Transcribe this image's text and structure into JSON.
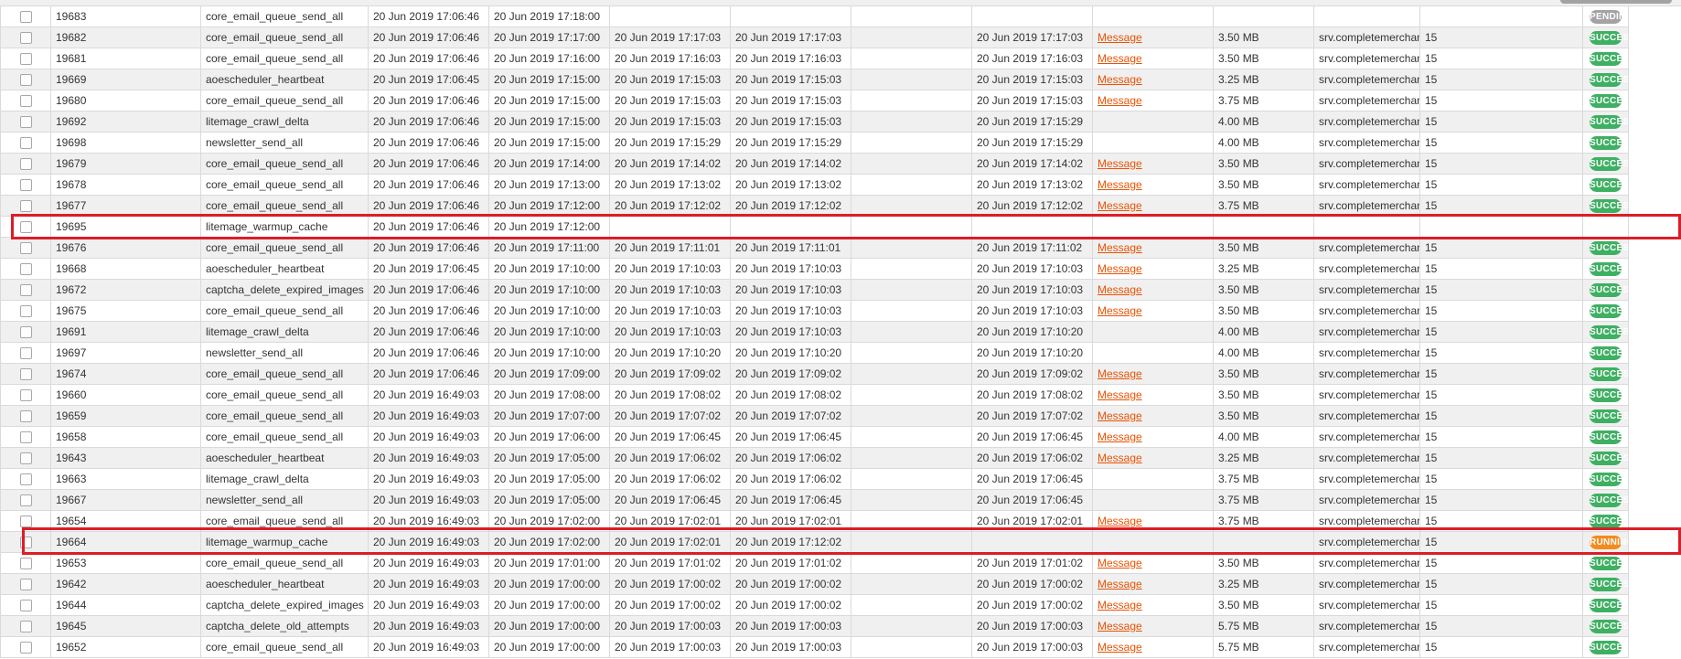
{
  "rows": [
    {
      "id": "19683",
      "code": "core_email_queue_send_all",
      "created": "20 Jun 2019 17:06:46",
      "scheduled": "20 Jun 2019 17:18:00",
      "executed": "",
      "finished": "",
      "c7": "",
      "last": "",
      "messages": "",
      "memory": "",
      "host": "",
      "pid": "",
      "status": "PENDING",
      "status_type": "pending"
    },
    {
      "id": "19682",
      "code": "core_email_queue_send_all",
      "created": "20 Jun 2019 17:06:46",
      "scheduled": "20 Jun 2019 17:17:00",
      "executed": "20 Jun 2019 17:17:03",
      "finished": "20 Jun 2019 17:17:03",
      "c7": "",
      "last": "20 Jun 2019 17:17:03",
      "messages": "Message",
      "memory": "3.50 MB",
      "host": "srv.completemerchandise.co.uk",
      "pid": "15",
      "status": "SUCCESS",
      "status_type": "success"
    },
    {
      "id": "19681",
      "code": "core_email_queue_send_all",
      "created": "20 Jun 2019 17:06:46",
      "scheduled": "20 Jun 2019 17:16:00",
      "executed": "20 Jun 2019 17:16:03",
      "finished": "20 Jun 2019 17:16:03",
      "c7": "",
      "last": "20 Jun 2019 17:16:03",
      "messages": "Message",
      "memory": "3.50 MB",
      "host": "srv.completemerchandise.co.uk",
      "pid": "15",
      "status": "SUCCESS",
      "status_type": "success"
    },
    {
      "id": "19669",
      "code": "aoescheduler_heartbeat",
      "created": "20 Jun 2019 17:06:45",
      "scheduled": "20 Jun 2019 17:15:00",
      "executed": "20 Jun 2019 17:15:03",
      "finished": "20 Jun 2019 17:15:03",
      "c7": "",
      "last": "20 Jun 2019 17:15:03",
      "messages": "Message",
      "memory": "3.25 MB",
      "host": "srv.completemerchandise.co.uk",
      "pid": "15",
      "status": "SUCCESS",
      "status_type": "success"
    },
    {
      "id": "19680",
      "code": "core_email_queue_send_all",
      "created": "20 Jun 2019 17:06:46",
      "scheduled": "20 Jun 2019 17:15:00",
      "executed": "20 Jun 2019 17:15:03",
      "finished": "20 Jun 2019 17:15:03",
      "c7": "",
      "last": "20 Jun 2019 17:15:03",
      "messages": "Message",
      "memory": "3.75 MB",
      "host": "srv.completemerchandise.co.uk",
      "pid": "15",
      "status": "SUCCESS",
      "status_type": "success"
    },
    {
      "id": "19692",
      "code": "litemage_crawl_delta",
      "created": "20 Jun 2019 17:06:46",
      "scheduled": "20 Jun 2019 17:15:00",
      "executed": "20 Jun 2019 17:15:03",
      "finished": "20 Jun 2019 17:15:03",
      "c7": "",
      "last": "20 Jun 2019 17:15:29",
      "messages": "",
      "memory": "4.00 MB",
      "host": "srv.completemerchandise.co.uk",
      "pid": "15",
      "status": "SUCCESS",
      "status_type": "success"
    },
    {
      "id": "19698",
      "code": "newsletter_send_all",
      "created": "20 Jun 2019 17:06:46",
      "scheduled": "20 Jun 2019 17:15:00",
      "executed": "20 Jun 2019 17:15:29",
      "finished": "20 Jun 2019 17:15:29",
      "c7": "",
      "last": "20 Jun 2019 17:15:29",
      "messages": "",
      "memory": "4.00 MB",
      "host": "srv.completemerchandise.co.uk",
      "pid": "15",
      "status": "SUCCESS",
      "status_type": "success"
    },
    {
      "id": "19679",
      "code": "core_email_queue_send_all",
      "created": "20 Jun 2019 17:06:46",
      "scheduled": "20 Jun 2019 17:14:00",
      "executed": "20 Jun 2019 17:14:02",
      "finished": "20 Jun 2019 17:14:02",
      "c7": "",
      "last": "20 Jun 2019 17:14:02",
      "messages": "Message",
      "memory": "3.50 MB",
      "host": "srv.completemerchandise.co.uk",
      "pid": "15",
      "status": "SUCCESS",
      "status_type": "success"
    },
    {
      "id": "19678",
      "code": "core_email_queue_send_all",
      "created": "20 Jun 2019 17:06:46",
      "scheduled": "20 Jun 2019 17:13:00",
      "executed": "20 Jun 2019 17:13:02",
      "finished": "20 Jun 2019 17:13:02",
      "c7": "",
      "last": "20 Jun 2019 17:13:02",
      "messages": "Message",
      "memory": "3.50 MB",
      "host": "srv.completemerchandise.co.uk",
      "pid": "15",
      "status": "SUCCESS",
      "status_type": "success"
    },
    {
      "id": "19677",
      "code": "core_email_queue_send_all",
      "created": "20 Jun 2019 17:06:46",
      "scheduled": "20 Jun 2019 17:12:00",
      "executed": "20 Jun 2019 17:12:02",
      "finished": "20 Jun 2019 17:12:02",
      "c7": "",
      "last": "20 Jun 2019 17:12:02",
      "messages": "Message",
      "memory": "3.75 MB",
      "host": "srv.completemerchandise.co.uk",
      "pid": "15",
      "status": "SUCCESS",
      "status_type": "success"
    },
    {
      "id": "19695",
      "code": "litemage_warmup_cache",
      "created": "20 Jun 2019 17:06:46",
      "scheduled": "20 Jun 2019 17:12:00",
      "executed": "",
      "finished": "",
      "c7": "",
      "last": "",
      "messages": "",
      "memory": "",
      "host": "",
      "pid": "",
      "status": "",
      "status_type": "none"
    },
    {
      "id": "19676",
      "code": "core_email_queue_send_all",
      "created": "20 Jun 2019 17:06:46",
      "scheduled": "20 Jun 2019 17:11:00",
      "executed": "20 Jun 2019 17:11:01",
      "finished": "20 Jun 2019 17:11:01",
      "c7": "",
      "last": "20 Jun 2019 17:11:02",
      "messages": "Message",
      "memory": "3.50 MB",
      "host": "srv.completemerchandise.co.uk",
      "pid": "15",
      "status": "SUCCESS",
      "status_type": "success"
    },
    {
      "id": "19668",
      "code": "aoescheduler_heartbeat",
      "created": "20 Jun 2019 17:06:45",
      "scheduled": "20 Jun 2019 17:10:00",
      "executed": "20 Jun 2019 17:10:03",
      "finished": "20 Jun 2019 17:10:03",
      "c7": "",
      "last": "20 Jun 2019 17:10:03",
      "messages": "Message",
      "memory": "3.25 MB",
      "host": "srv.completemerchandise.co.uk",
      "pid": "15",
      "status": "SUCCESS",
      "status_type": "success"
    },
    {
      "id": "19672",
      "code": "captcha_delete_expired_images",
      "created": "20 Jun 2019 17:06:46",
      "scheduled": "20 Jun 2019 17:10:00",
      "executed": "20 Jun 2019 17:10:03",
      "finished": "20 Jun 2019 17:10:03",
      "c7": "",
      "last": "20 Jun 2019 17:10:03",
      "messages": "Message",
      "memory": "3.50 MB",
      "host": "srv.completemerchandise.co.uk",
      "pid": "15",
      "status": "SUCCESS",
      "status_type": "success"
    },
    {
      "id": "19675",
      "code": "core_email_queue_send_all",
      "created": "20 Jun 2019 17:06:46",
      "scheduled": "20 Jun 2019 17:10:00",
      "executed": "20 Jun 2019 17:10:03",
      "finished": "20 Jun 2019 17:10:03",
      "c7": "",
      "last": "20 Jun 2019 17:10:03",
      "messages": "Message",
      "memory": "3.50 MB",
      "host": "srv.completemerchandise.co.uk",
      "pid": "15",
      "status": "SUCCESS",
      "status_type": "success"
    },
    {
      "id": "19691",
      "code": "litemage_crawl_delta",
      "created": "20 Jun 2019 17:06:46",
      "scheduled": "20 Jun 2019 17:10:00",
      "executed": "20 Jun 2019 17:10:03",
      "finished": "20 Jun 2019 17:10:03",
      "c7": "",
      "last": "20 Jun 2019 17:10:20",
      "messages": "",
      "memory": "4.00 MB",
      "host": "srv.completemerchandise.co.uk",
      "pid": "15",
      "status": "SUCCESS",
      "status_type": "success"
    },
    {
      "id": "19697",
      "code": "newsletter_send_all",
      "created": "20 Jun 2019 17:06:46",
      "scheduled": "20 Jun 2019 17:10:00",
      "executed": "20 Jun 2019 17:10:20",
      "finished": "20 Jun 2019 17:10:20",
      "c7": "",
      "last": "20 Jun 2019 17:10:20",
      "messages": "",
      "memory": "4.00 MB",
      "host": "srv.completemerchandise.co.uk",
      "pid": "15",
      "status": "SUCCESS",
      "status_type": "success"
    },
    {
      "id": "19674",
      "code": "core_email_queue_send_all",
      "created": "20 Jun 2019 17:06:46",
      "scheduled": "20 Jun 2019 17:09:00",
      "executed": "20 Jun 2019 17:09:02",
      "finished": "20 Jun 2019 17:09:02",
      "c7": "",
      "last": "20 Jun 2019 17:09:02",
      "messages": "Message",
      "memory": "3.50 MB",
      "host": "srv.completemerchandise.co.uk",
      "pid": "15",
      "status": "SUCCESS",
      "status_type": "success"
    },
    {
      "id": "19660",
      "code": "core_email_queue_send_all",
      "created": "20 Jun 2019 16:49:03",
      "scheduled": "20 Jun 2019 17:08:00",
      "executed": "20 Jun 2019 17:08:02",
      "finished": "20 Jun 2019 17:08:02",
      "c7": "",
      "last": "20 Jun 2019 17:08:02",
      "messages": "Message",
      "memory": "3.50 MB",
      "host": "srv.completemerchandise.co.uk",
      "pid": "15",
      "status": "SUCCESS",
      "status_type": "success"
    },
    {
      "id": "19659",
      "code": "core_email_queue_send_all",
      "created": "20 Jun 2019 16:49:03",
      "scheduled": "20 Jun 2019 17:07:00",
      "executed": "20 Jun 2019 17:07:02",
      "finished": "20 Jun 2019 17:07:02",
      "c7": "",
      "last": "20 Jun 2019 17:07:02",
      "messages": "Message",
      "memory": "3.50 MB",
      "host": "srv.completemerchandise.co.uk",
      "pid": "15",
      "status": "SUCCESS",
      "status_type": "success"
    },
    {
      "id": "19658",
      "code": "core_email_queue_send_all",
      "created": "20 Jun 2019 16:49:03",
      "scheduled": "20 Jun 2019 17:06:00",
      "executed": "20 Jun 2019 17:06:45",
      "finished": "20 Jun 2019 17:06:45",
      "c7": "",
      "last": "20 Jun 2019 17:06:45",
      "messages": "Message",
      "memory": "4.00 MB",
      "host": "srv.completemerchandise.co.uk",
      "pid": "15",
      "status": "SUCCESS",
      "status_type": "success"
    },
    {
      "id": "19643",
      "code": "aoescheduler_heartbeat",
      "created": "20 Jun 2019 16:49:03",
      "scheduled": "20 Jun 2019 17:05:00",
      "executed": "20 Jun 2019 17:06:02",
      "finished": "20 Jun 2019 17:06:02",
      "c7": "",
      "last": "20 Jun 2019 17:06:02",
      "messages": "Message",
      "memory": "3.25 MB",
      "host": "srv.completemerchandise.co.uk",
      "pid": "15",
      "status": "SUCCESS",
      "status_type": "success"
    },
    {
      "id": "19663",
      "code": "litemage_crawl_delta",
      "created": "20 Jun 2019 16:49:03",
      "scheduled": "20 Jun 2019 17:05:00",
      "executed": "20 Jun 2019 17:06:02",
      "finished": "20 Jun 2019 17:06:02",
      "c7": "",
      "last": "20 Jun 2019 17:06:45",
      "messages": "",
      "memory": "3.75 MB",
      "host": "srv.completemerchandise.co.uk",
      "pid": "15",
      "status": "SUCCESS",
      "status_type": "success"
    },
    {
      "id": "19667",
      "code": "newsletter_send_all",
      "created": "20 Jun 2019 16:49:03",
      "scheduled": "20 Jun 2019 17:05:00",
      "executed": "20 Jun 2019 17:06:45",
      "finished": "20 Jun 2019 17:06:45",
      "c7": "",
      "last": "20 Jun 2019 17:06:45",
      "messages": "",
      "memory": "3.75 MB",
      "host": "srv.completemerchandise.co.uk",
      "pid": "15",
      "status": "SUCCESS",
      "status_type": "success"
    },
    {
      "id": "19654",
      "code": "core_email_queue_send_all",
      "created": "20 Jun 2019 16:49:03",
      "scheduled": "20 Jun 2019 17:02:00",
      "executed": "20 Jun 2019 17:02:01",
      "finished": "20 Jun 2019 17:02:01",
      "c7": "",
      "last": "20 Jun 2019 17:02:01",
      "messages": "Message",
      "memory": "3.75 MB",
      "host": "srv.completemerchandise.co.uk",
      "pid": "15",
      "status": "SUCCESS",
      "status_type": "success"
    },
    {
      "id": "19664",
      "code": "litemage_warmup_cache",
      "created": "20 Jun 2019 16:49:03",
      "scheduled": "20 Jun 2019 17:02:00",
      "executed": "20 Jun 2019 17:02:01",
      "finished": "20 Jun 2019 17:12:02",
      "c7": "",
      "last": "",
      "messages": "",
      "memory": "",
      "host": "srv.completemerchandise.co.uk",
      "pid": "15",
      "status": "RUNNING",
      "status_type": "running"
    },
    {
      "id": "19653",
      "code": "core_email_queue_send_all",
      "created": "20 Jun 2019 16:49:03",
      "scheduled": "20 Jun 2019 17:01:00",
      "executed": "20 Jun 2019 17:01:02",
      "finished": "20 Jun 2019 17:01:02",
      "c7": "",
      "last": "20 Jun 2019 17:01:02",
      "messages": "Message",
      "memory": "3.50 MB",
      "host": "srv.completemerchandise.co.uk",
      "pid": "15",
      "status": "SUCCESS",
      "status_type": "success"
    },
    {
      "id": "19642",
      "code": "aoescheduler_heartbeat",
      "created": "20 Jun 2019 16:49:03",
      "scheduled": "20 Jun 2019 17:00:00",
      "executed": "20 Jun 2019 17:00:02",
      "finished": "20 Jun 2019 17:00:02",
      "c7": "",
      "last": "20 Jun 2019 17:00:02",
      "messages": "Message",
      "memory": "3.25 MB",
      "host": "srv.completemerchandise.co.uk",
      "pid": "15",
      "status": "SUCCESS",
      "status_type": "success"
    },
    {
      "id": "19644",
      "code": "captcha_delete_expired_images",
      "created": "20 Jun 2019 16:49:03",
      "scheduled": "20 Jun 2019 17:00:00",
      "executed": "20 Jun 2019 17:00:02",
      "finished": "20 Jun 2019 17:00:02",
      "c7": "",
      "last": "20 Jun 2019 17:00:02",
      "messages": "Message",
      "memory": "3.50 MB",
      "host": "srv.completemerchandise.co.uk",
      "pid": "15",
      "status": "SUCCESS",
      "status_type": "success"
    },
    {
      "id": "19645",
      "code": "captcha_delete_old_attempts",
      "created": "20 Jun 2019 16:49:03",
      "scheduled": "20 Jun 2019 17:00:00",
      "executed": "20 Jun 2019 17:00:03",
      "finished": "20 Jun 2019 17:00:03",
      "c7": "",
      "last": "20 Jun 2019 17:00:03",
      "messages": "Message",
      "memory": "5.75 MB",
      "host": "srv.completemerchandise.co.uk",
      "pid": "15",
      "status": "SUCCESS",
      "status_type": "success"
    },
    {
      "id": "19652",
      "code": "core_email_queue_send_all",
      "created": "20 Jun 2019 16:49:03",
      "scheduled": "20 Jun 2019 17:00:00",
      "executed": "20 Jun 2019 17:00:03",
      "finished": "20 Jun 2019 17:00:03",
      "c7": "",
      "last": "20 Jun 2019 17:00:03",
      "messages": "Message",
      "memory": "5.75 MB",
      "host": "srv.completemerchandise.co.uk",
      "pid": "15",
      "status": "SUCCESS",
      "status_type": "success"
    }
  ],
  "colors": {
    "success": "#3fb063",
    "pending": "#a3a3a3",
    "running": "#f48b1f",
    "link": "#eb5202",
    "highlight": "#dd1d27"
  },
  "icons": {
    "row_checkbox": "checkbox-icon"
  }
}
